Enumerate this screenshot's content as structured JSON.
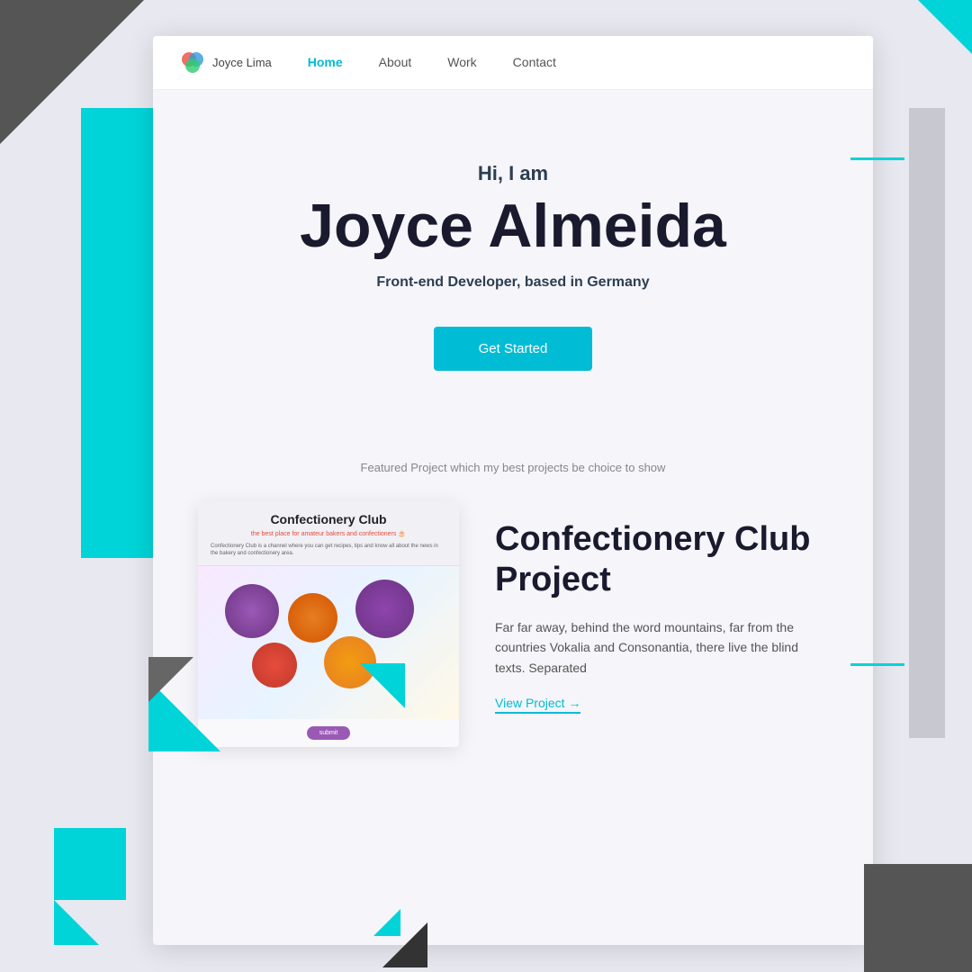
{
  "brand": {
    "logo_text": "Joyce Lima",
    "logo_icon": "🎨"
  },
  "navbar": {
    "links": [
      {
        "label": "Home",
        "active": true
      },
      {
        "label": "About",
        "active": false
      },
      {
        "label": "Work",
        "active": false
      },
      {
        "label": "Contact",
        "active": false
      }
    ]
  },
  "hero": {
    "greeting": "Hi, I am",
    "name": "Joyce Almeida",
    "subtitle": "Front-end Developer, based in Germany",
    "cta_label": "Get Started"
  },
  "featured": {
    "label": "Featured Project which my best projects be choice to show"
  },
  "project": {
    "title": "Confectionery Club Project",
    "mockup_title": "Confectionery Club",
    "mockup_desc": "the best place for amateur bakers and confectioners 🎂",
    "mockup_body": "Confectionery Club is a channel where you can get recipes, tips and know all about the news in the bakery and confectionery area.",
    "body": "Far far away, behind the word mountains, far from the countries Vokalia and Consonantia, there live the blind texts. Separated",
    "cta_label": "submit",
    "link_label": "View Project →"
  }
}
